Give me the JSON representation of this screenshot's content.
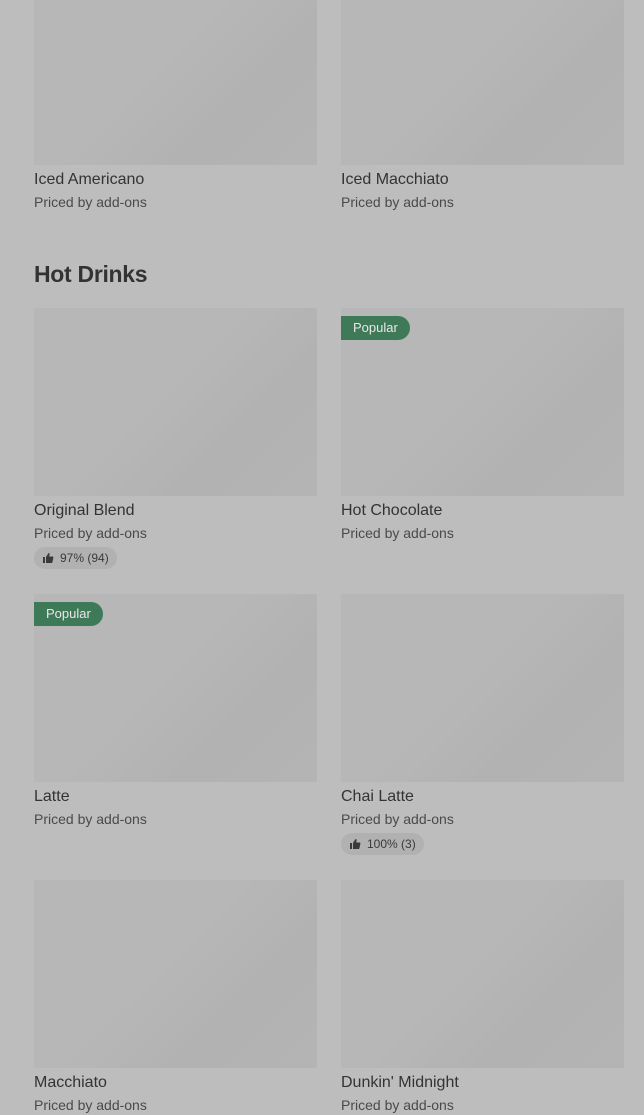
{
  "top_row": {
    "items": [
      {
        "name": "Iced Americano",
        "price": "Priced by add-ons"
      },
      {
        "name": "Iced Macchiato",
        "price": "Priced by add-ons"
      }
    ]
  },
  "hot_drinks": {
    "title": "Hot Drinks",
    "items": [
      {
        "name": "Original Blend",
        "price": "Priced by add-ons",
        "rating": "97% (94)"
      },
      {
        "name": "Hot Chocolate",
        "price": "Priced by add-ons",
        "badge": "Popular"
      },
      {
        "name": "Latte",
        "price": "Priced by add-ons",
        "badge": "Popular"
      },
      {
        "name": "Chai Latte",
        "price": "Priced by add-ons",
        "rating": "100% (3)"
      },
      {
        "name": "Macchiato",
        "price": "Priced by add-ons"
      },
      {
        "name": "Dunkin' Midnight",
        "price": "Priced by add-ons"
      }
    ]
  },
  "colors": {
    "badge_bg": "#3e7a57",
    "page_bg": "#bdbdbd"
  }
}
